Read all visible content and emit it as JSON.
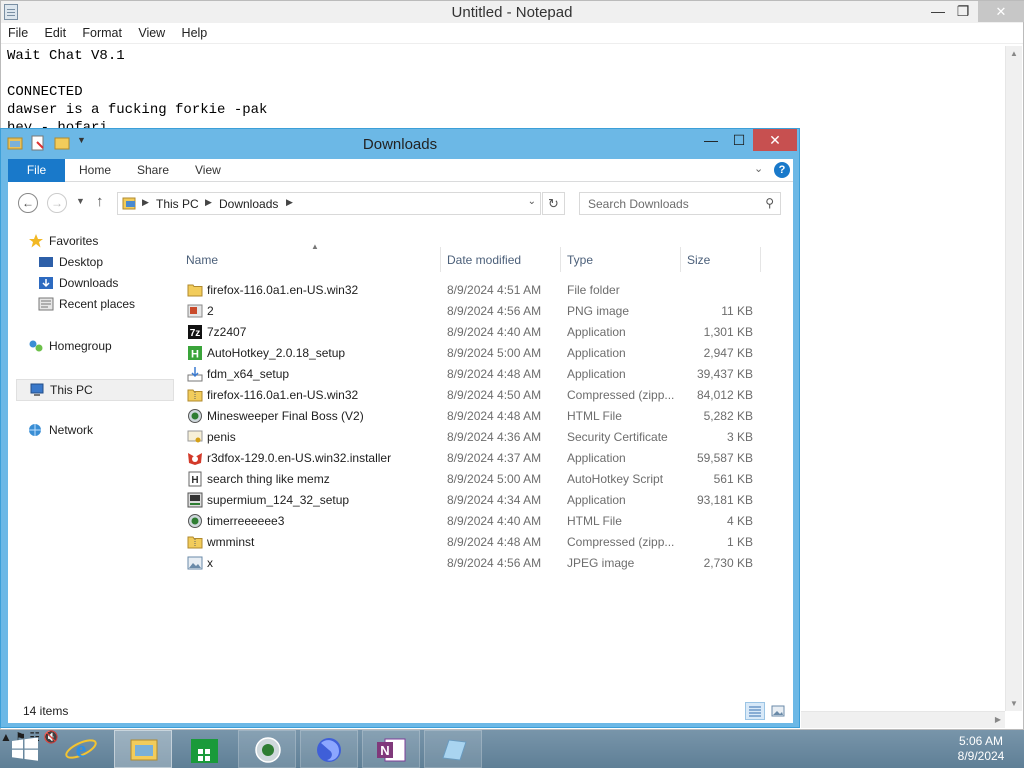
{
  "notepad": {
    "title": "Untitled - Notepad",
    "menu": [
      "File",
      "Edit",
      "Format",
      "View",
      "Help"
    ],
    "lines": [
      "Wait Chat V8.1",
      "",
      "CONNECTED",
      "dawser is a fucking forkie -pak",
      "hey - hofari"
    ]
  },
  "explorer": {
    "title": "Downloads",
    "tabs": {
      "file": "File",
      "home": "Home",
      "share": "Share",
      "view": "View"
    },
    "address": {
      "segments": [
        "This PC",
        "Downloads"
      ]
    },
    "search_placeholder": "Search Downloads",
    "nav": {
      "favorites": "Favorites",
      "desktop": "Desktop",
      "downloads": "Downloads",
      "recent": "Recent places",
      "homegroup": "Homegroup",
      "thispc": "This PC",
      "network": "Network"
    },
    "columns": {
      "name": "Name",
      "date": "Date modified",
      "type": "Type",
      "size": "Size"
    },
    "files": [
      {
        "name": "firefox-116.0a1.en-US.win32",
        "date": "8/9/2024 4:51 AM",
        "type": "File folder",
        "size": "",
        "icon": "folder-icon"
      },
      {
        "name": "2",
        "date": "8/9/2024 4:56 AM",
        "type": "PNG image",
        "size": "11 KB",
        "icon": "png-file-icon"
      },
      {
        "name": "7z2407",
        "date": "8/9/2024 4:40 AM",
        "type": "Application",
        "size": "1,301 KB",
        "icon": "7zip-icon"
      },
      {
        "name": "AutoHotkey_2.0.18_setup",
        "date": "8/9/2024 5:00 AM",
        "type": "Application",
        "size": "2,947 KB",
        "icon": "autohotkey-icon"
      },
      {
        "name": "fdm_x64_setup",
        "date": "8/9/2024 4:48 AM",
        "type": "Application",
        "size": "39,437 KB",
        "icon": "installer-icon"
      },
      {
        "name": "firefox-116.0a1.en-US.win32",
        "date": "8/9/2024 4:50 AM",
        "type": "Compressed (zipp...",
        "size": "84,012 KB",
        "icon": "zip-folder-icon"
      },
      {
        "name": "Minesweeper Final Boss (V2)",
        "date": "8/9/2024 4:48 AM",
        "type": "HTML File",
        "size": "5,282 KB",
        "icon": "html-file-icon"
      },
      {
        "name": "penis",
        "date": "8/9/2024 4:36 AM",
        "type": "Security Certificate",
        "size": "3 KB",
        "icon": "certificate-icon"
      },
      {
        "name": "r3dfox-129.0.en-US.win32.installer",
        "date": "8/9/2024 4:37 AM",
        "type": "Application",
        "size": "59,587 KB",
        "icon": "r3dfox-icon"
      },
      {
        "name": "search thing like memz",
        "date": "8/9/2024 5:00 AM",
        "type": "AutoHotkey Script",
        "size": "561 KB",
        "icon": "ahk-script-icon"
      },
      {
        "name": "supermium_124_32_setup",
        "date": "8/9/2024 4:34 AM",
        "type": "Application",
        "size": "93,181 KB",
        "icon": "setup-icon"
      },
      {
        "name": "timerreeeeee3",
        "date": "8/9/2024 4:40 AM",
        "type": "HTML File",
        "size": "4 KB",
        "icon": "html-file-icon"
      },
      {
        "name": "wmminst",
        "date": "8/9/2024 4:48 AM",
        "type": "Compressed (zipp...",
        "size": "1 KB",
        "icon": "zip-folder-icon"
      },
      {
        "name": "x",
        "date": "8/9/2024 4:56 AM",
        "type": "JPEG image",
        "size": "2,730 KB",
        "icon": "jpeg-file-icon"
      }
    ],
    "status": "14 items"
  },
  "taskbar": {
    "time": "5:06 AM",
    "date": "8/9/2024"
  },
  "colors": {
    "accent": "#1979ca",
    "frame": "#6cb8e6",
    "close": "#c75050"
  }
}
